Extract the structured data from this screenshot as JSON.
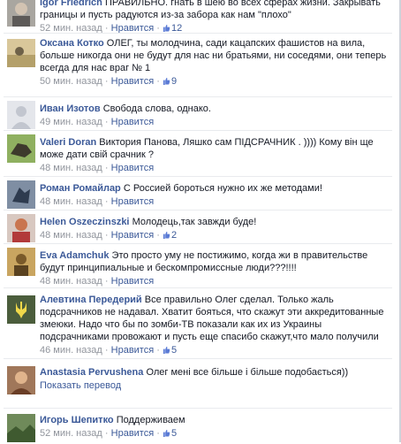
{
  "comments": [
    {
      "name": "Igor Friedrich",
      "text": "ПРАВИЛЬНО. гнать в шею во всех сферах жизни. Закрывать границы и пусть радуются из-за забора как нам \"плохо\"",
      "time": "52 мин. назад",
      "dot": "·",
      "like_label": "Нравится",
      "likes": "12",
      "avatar": "avatar-icon"
    },
    {
      "name": "Оксана Котко",
      "text": "ОЛЕГ, ты молодчина, сади кацапских фашистов на вила, больше никогда они не будут для нас ни братьями, ни соседями, они теперь всегда для нас враг № 1",
      "time": "50 мин. назад",
      "dot": "·",
      "like_label": "Нравится",
      "likes": "9",
      "avatar": "avatar-icon"
    },
    {
      "name": "Иван Изотов",
      "text": "Свобода слова, однако.",
      "time": "49 мин. назад",
      "dot": "·",
      "like_label": "Нравится",
      "likes": "",
      "avatar": "default-avatar-icon"
    },
    {
      "name": "Valeri Doran",
      "text": "Виктория Панова, Ляшко сам ПІДСРАЧНИК . )))) Кому він ще може дати свій срачник ?",
      "time": "48 мин. назад",
      "dot": "·",
      "like_label": "Нравится",
      "likes": "",
      "avatar": "avatar-icon"
    },
    {
      "name": "Роман Ромайлар",
      "text": "С Россией бороться нужно их же методами!",
      "time": "48 мин. назад",
      "dot": "·",
      "like_label": "Нравится",
      "likes": "",
      "avatar": "avatar-icon"
    },
    {
      "name": "Helen Oszeczinszki",
      "text": "Молодець,так завжди буде!",
      "time": "48 мин. назад",
      "dot": "·",
      "like_label": "Нравится",
      "likes": "2",
      "avatar": "avatar-icon"
    },
    {
      "name": "Eva Adamchuk",
      "text": "Это просто уму не постижимо, когда жи в правительстве будут принципиальные и бескомпромиссные люди???!!!!",
      "time": "48 мин. назад",
      "dot": "·",
      "like_label": "Нравится",
      "likes": "",
      "avatar": "avatar-icon"
    },
    {
      "name": "Алевтина Передерий",
      "text": "Все правильно Олег сделал. Только жаль подсрачников не надавал. Хватит бояться, что скажут эти аккредитованные змеюки. Надо что бы по зомби-ТВ показали как их из Украины подсрачниками провожают и пусть еще спасибо скажут,что мало получили",
      "time": "46 мин. назад",
      "dot": "·",
      "like_label": "Нравится",
      "likes": "5",
      "avatar": "trident-icon"
    },
    {
      "name": "Anastasia Pervushena",
      "text": "Олег мені все більше і більше подобається))",
      "translate": "Показать перевод",
      "time": "",
      "dot": "",
      "like_label": "",
      "likes": "",
      "avatar": "avatar-icon"
    },
    {
      "name": "Игорь Шепитко",
      "text": "Поддерживаем",
      "time": "52 мин. назад",
      "dot": "·",
      "like_label": "Нравится",
      "likes": "5",
      "avatar": "avatar-icon"
    }
  ]
}
